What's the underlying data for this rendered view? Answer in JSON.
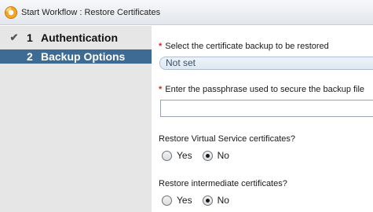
{
  "window": {
    "title": "Start Workflow : Restore Certificates"
  },
  "steps": [
    {
      "number": "1",
      "label": "Authentication",
      "status": "complete"
    },
    {
      "number": "2",
      "label": "Backup Options",
      "status": "active"
    }
  ],
  "form": {
    "backup": {
      "required_marker": "*",
      "label": "Select the certificate backup to be restored",
      "value": "Not set"
    },
    "passphrase": {
      "required_marker": "*",
      "label": "Enter the passphrase used to secure the backup file",
      "value": ""
    },
    "restore_vs": {
      "label": "Restore Virtual Service certificates?",
      "yes_label": "Yes",
      "no_label": "No",
      "selected": "No"
    },
    "restore_intermediate": {
      "label": "Restore intermediate certificates?",
      "yes_label": "Yes",
      "no_label": "No",
      "selected": "No"
    }
  },
  "colors": {
    "active_step_bg": "#3d6b93",
    "required": "#d9251d"
  }
}
